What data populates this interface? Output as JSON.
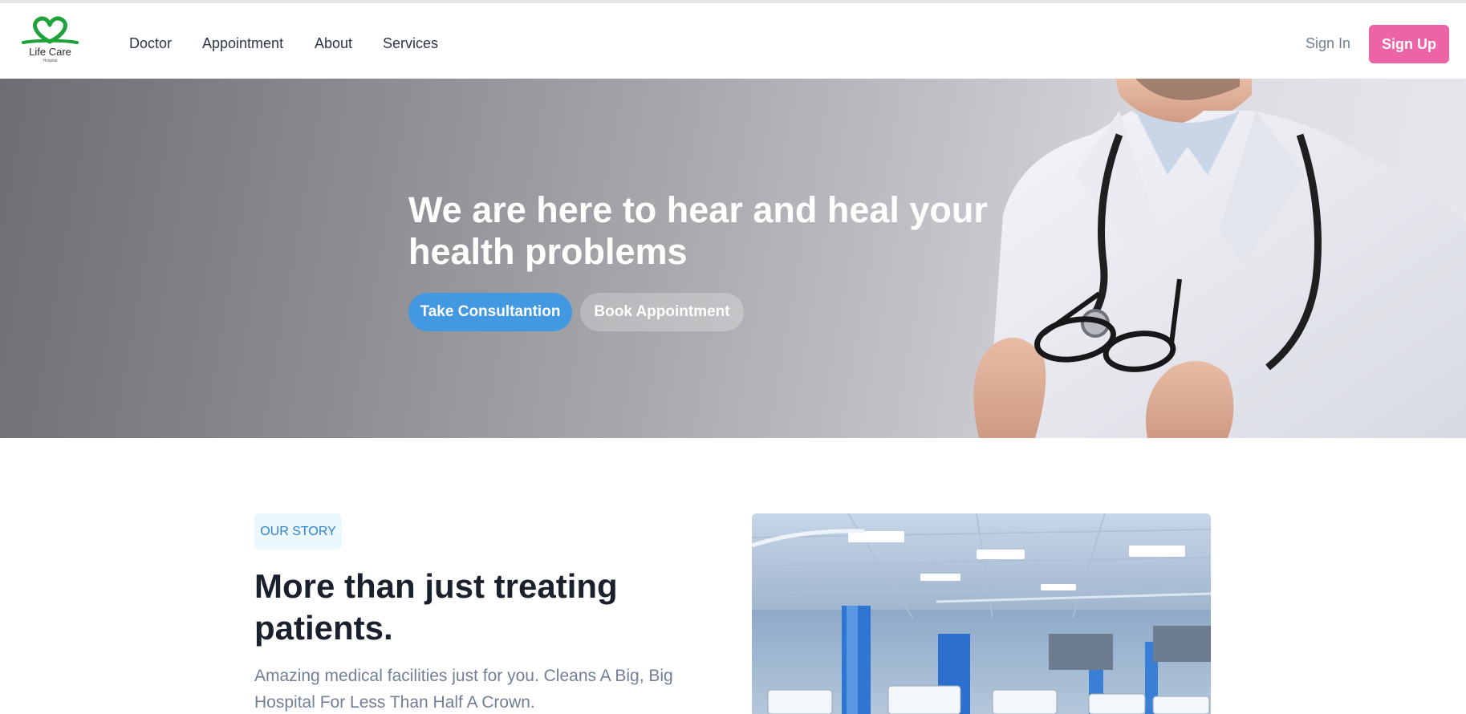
{
  "brand": {
    "name": "Life Care",
    "sub": "Hospital",
    "colors": {
      "green": "#1ea23a",
      "accent_pink": "#ed64a6",
      "accent_blue": "#4299e1"
    }
  },
  "nav": {
    "links": [
      "Doctor",
      "Appointment",
      "About",
      "Services"
    ],
    "sign_in": "Sign In",
    "sign_up": "Sign Up"
  },
  "hero": {
    "title": "We are here to hear and heal your health problems",
    "buttons": {
      "consult": "Take Consultantion",
      "book": "Book Appointment"
    },
    "image": "doctor-with-stethoscope-holding-glasses"
  },
  "story": {
    "badge": "OUR STORY",
    "title": "More than just treating patients.",
    "text": "Amazing medical facilities just for you. Cleans A Big, Big Hospital For Less Than Half A Crown.",
    "image": "hospital-ward"
  }
}
